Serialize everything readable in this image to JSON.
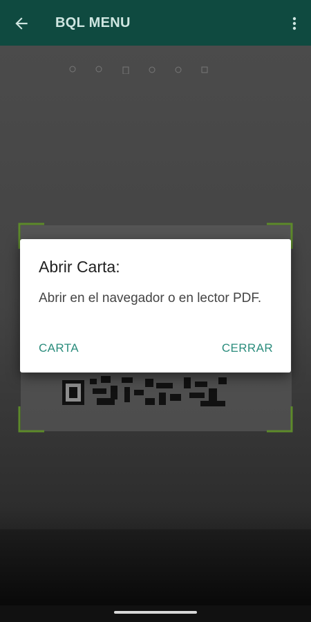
{
  "appbar": {
    "title": "BQL MENU",
    "back_icon": "arrow-back-icon",
    "more_icon": "more-vert-icon",
    "background": "#0f4a40"
  },
  "dialog": {
    "title": "Abrir Carta:",
    "message": "Abrir en el navegador o en lector PDF.",
    "positive_button": "CARTA",
    "negative_button": "CERRAR",
    "accent": "#2a8c7c"
  },
  "scanner": {
    "frame_color": "#5d8a2a"
  }
}
